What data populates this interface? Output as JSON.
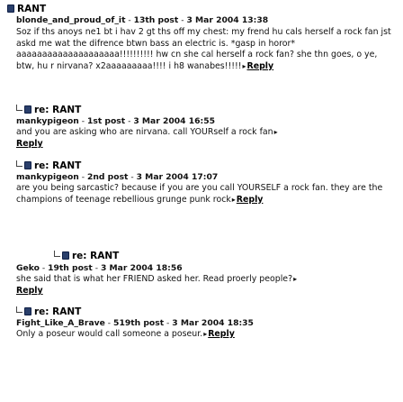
{
  "posts": [
    {
      "is_reply": false,
      "title": "RANT",
      "meta": {
        "author": "blonde_and_proud_of_it",
        "sep1": " - ",
        "number": "13th post",
        "sep2": " - ",
        "date": "3 Mar 2004 13:38"
      },
      "body": "Soz if ths anoys ne1 bt i hav 2 gt ths off my chest: my frend hu cals herself a rock fan jst askd me wat the difrence btwn bass an electric is. *gasp in horor* aaaaaaaaaaaaaaaaaaaa!!!!!!!!!! hw cn she cal herself a rock fan? she thn goes, o ye, btw, hu r nirvana? x2aaaaaaaaa!!!! i h8 wanabes!!!!!",
      "reply_label": "Reply"
    },
    {
      "is_reply": true,
      "title": "re: RANT",
      "meta": {
        "author": "mankypigeon",
        "sep1": " - ",
        "number": "1st post",
        "sep2": " - ",
        "date": "3 Mar 2004 16:55"
      },
      "body": "and you are asking who are nirvana. call YOURself a rock fan",
      "reply_label": "Reply"
    },
    {
      "is_reply": true,
      "title": "re: RANT",
      "meta": {
        "author": "mankypigeon",
        "sep1": " - ",
        "number": "2nd post",
        "sep2": " - ",
        "date": "3 Mar 2004 17:07"
      },
      "body": "are you being sarcastic? because if you are you call YOURSELF a rock fan. they are the champions of teenage rebellious grunge punk rock",
      "reply_label": "Reply"
    },
    {
      "is_reply": true,
      "title": "re: RANT",
      "meta": {
        "author": "Geko",
        "sep1": " - ",
        "number": "19th post",
        "sep2": " - ",
        "date": "3 Mar 2004 18:56"
      },
      "body": "she said that is what her FRIEND asked her. Read proerly people?",
      "reply_label": "Reply"
    },
    {
      "is_reply": true,
      "title": "re: RANT",
      "meta": {
        "author": "Fight_Like_A_Brave",
        "sep1": " - ",
        "number": "519th post",
        "sep2": " - ",
        "date": "3 Mar 2004 18:35"
      },
      "body": "Only a poseur would call someone a poseur.",
      "reply_label": "Reply"
    }
  ]
}
